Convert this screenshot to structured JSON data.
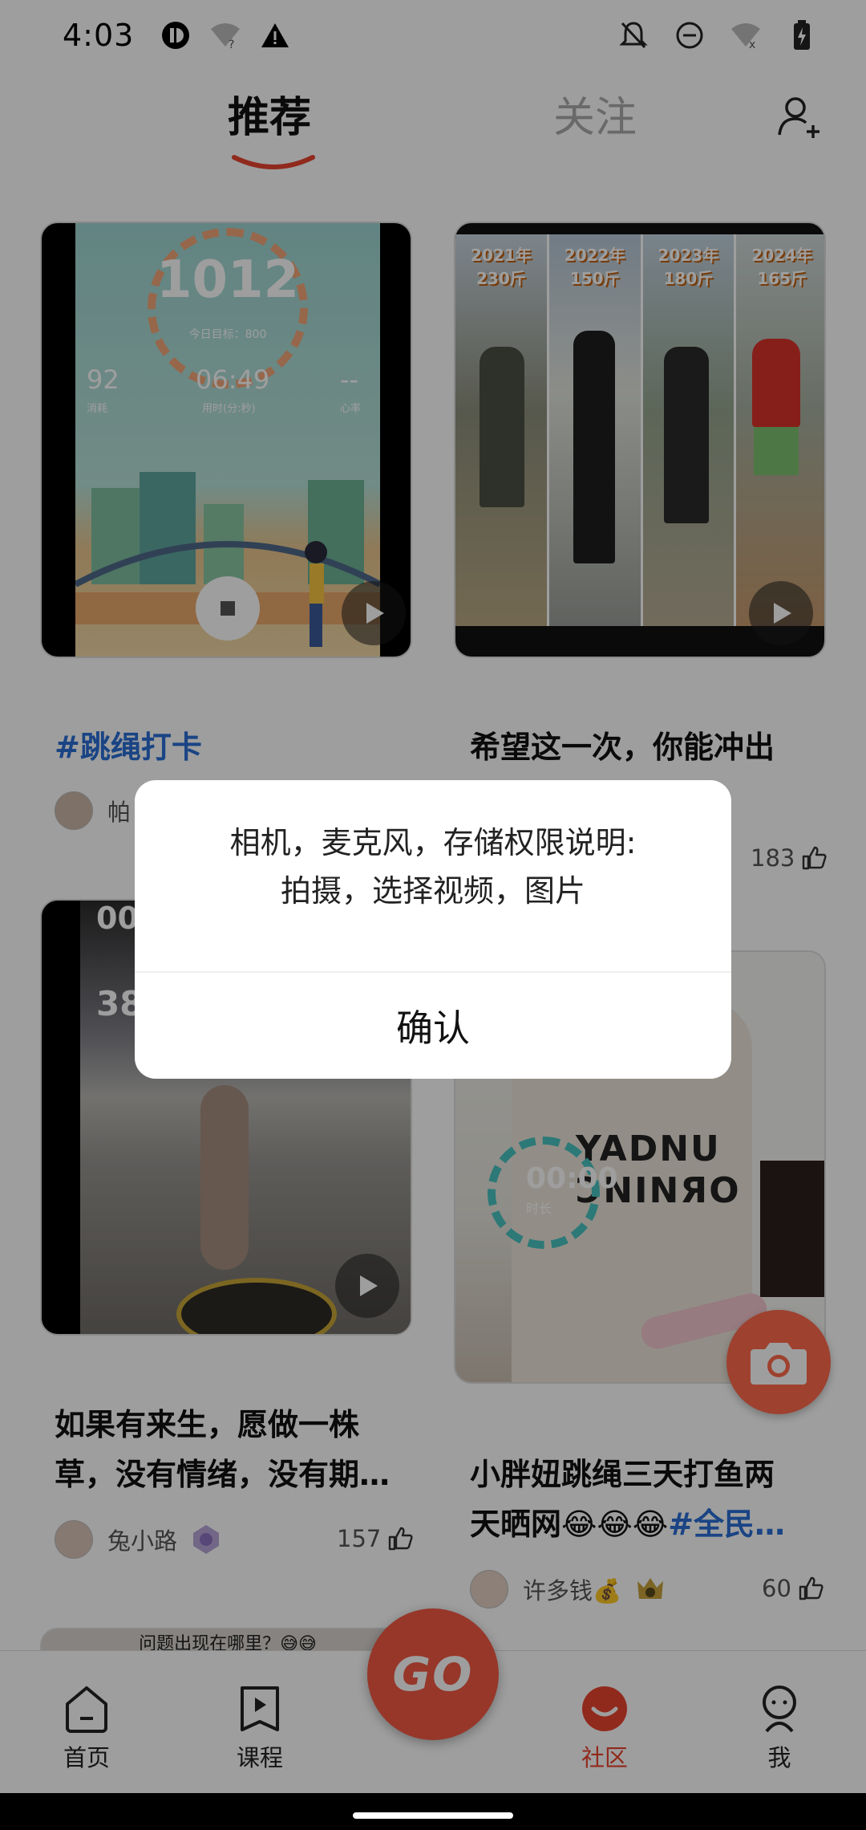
{
  "status_bar": {
    "time": "4:03"
  },
  "tabs": {
    "recommend": "推荐",
    "follow": "关注"
  },
  "feed": {
    "cards": [
      {
        "title_hashtag": "#跳绳打卡",
        "author": "帕",
        "likes": ""
      },
      {
        "title": "希望这一次，你能冲出",
        "likes": "183"
      },
      {
        "title_line1": "如果有来生，愿做一株",
        "title_line2": "草，没有情绪，没有期…",
        "author": "兔小路",
        "likes": "157"
      },
      {
        "title_line1": "小胖妞跳绳三天打鱼两",
        "title_line2_text": "天晒网😂😂😂",
        "title_line2_tag": "#全民…",
        "author": "许多钱💰",
        "likes": "60"
      }
    ],
    "card1_stats": {
      "count": "1012",
      "goal": "今日目标：800",
      "left": "92",
      "left_label": "消耗",
      "mid": "06:49",
      "mid_label": "用时(分:秒)",
      "right": "--",
      "right_label": "心率"
    },
    "card2_labels": [
      "2021年\n230斤",
      "2022年\n150斤",
      "2023年\n180斤",
      "2024年\n165斤"
    ],
    "card3_overlay": {
      "time": "00:",
      "count": "380"
    },
    "card4_overlay": {
      "time": "00:00",
      "label": "时长",
      "shirt": "YADNU\nƆNINЯO"
    },
    "card5_banner": "问题出现在哪里？😅😅"
  },
  "bottom_nav": {
    "items": [
      {
        "label": "首页",
        "icon": "home-icon"
      },
      {
        "label": "课程",
        "icon": "course-icon"
      },
      {
        "label": "社区",
        "icon": "community-icon",
        "active": true
      },
      {
        "label": "我",
        "icon": "profile-icon"
      }
    ],
    "go_label": "GO"
  },
  "dialog": {
    "line1": "相机，麦克风，存储权限说明:",
    "line2": "拍摄，选择视频，图片",
    "confirm": "确认"
  },
  "colors": {
    "accent": "#e8452f",
    "hashtag": "#2a6fd6"
  }
}
